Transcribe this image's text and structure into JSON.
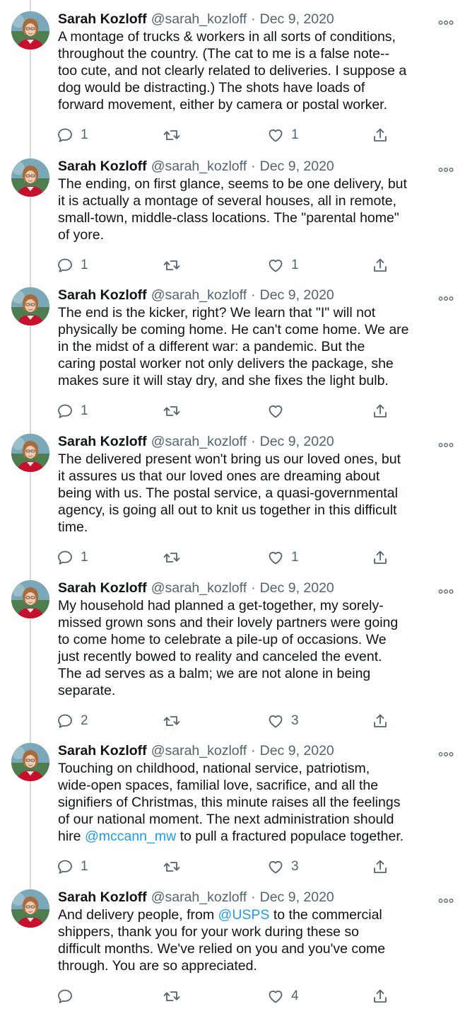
{
  "tweets": [
    {
      "name": "Sarah Kozloff",
      "handle": "@sarah_kozloff",
      "separator": "·",
      "date": "Dec 9, 2020",
      "lines": [
        [
          {
            "t": "A montage of trucks & workers in all sorts of conditions,"
          }
        ],
        [
          {
            "t": "throughout the country. (The cat to me is a false note--"
          }
        ],
        [
          {
            "t": "too cute, and not clearly related to deliveries. I suppose a"
          }
        ],
        [
          {
            "t": "dog would be distracting.) The shots have loads of"
          }
        ],
        [
          {
            "t": "forward movement, either by camera or postal worker."
          }
        ]
      ],
      "replies": "1",
      "retweets": "",
      "likes": "1"
    },
    {
      "name": "Sarah Kozloff",
      "handle": "@sarah_kozloff",
      "separator": "·",
      "date": "Dec 9, 2020",
      "lines": [
        [
          {
            "t": "The ending, on first glance, seems to be one delivery, but"
          }
        ],
        [
          {
            "t": "it is actually a montage of several houses, all in remote,"
          }
        ],
        [
          {
            "t": "small-town, middle-class locations. The \"parental home\""
          }
        ],
        [
          {
            "t": "of yore."
          }
        ]
      ],
      "replies": "1",
      "retweets": "",
      "likes": "1"
    },
    {
      "name": "Sarah Kozloff",
      "handle": "@sarah_kozloff",
      "separator": "·",
      "date": "Dec 9, 2020",
      "lines": [
        [
          {
            "t": "The end is the kicker, right? We learn that \"I\" will not"
          }
        ],
        [
          {
            "t": "physically be coming home. He can't come home. We are"
          }
        ],
        [
          {
            "t": "in the midst of a different war: a pandemic. But the"
          }
        ],
        [
          {
            "t": "caring postal worker not only delivers the package, she"
          }
        ],
        [
          {
            "t": "makes sure it will stay dry, and she fixes the light bulb."
          }
        ]
      ],
      "replies": "1",
      "retweets": "",
      "likes": ""
    },
    {
      "name": "Sarah Kozloff",
      "handle": "@sarah_kozloff",
      "separator": "·",
      "date": "Dec 9, 2020",
      "lines": [
        [
          {
            "t": "The delivered present won't bring us our loved ones, but"
          }
        ],
        [
          {
            "t": "it assures us that our loved ones are dreaming about"
          }
        ],
        [
          {
            "t": "being with us. The postal service, a quasi-governmental"
          }
        ],
        [
          {
            "t": "agency, is going all out to knit us together in this difficult"
          }
        ],
        [
          {
            "t": "time."
          }
        ]
      ],
      "replies": "1",
      "retweets": "",
      "likes": "1"
    },
    {
      "name": "Sarah Kozloff",
      "handle": "@sarah_kozloff",
      "separator": "·",
      "date": "Dec 9, 2020",
      "lines": [
        [
          {
            "t": "My household had planned a get-together, my sorely-"
          }
        ],
        [
          {
            "t": "missed grown sons and their lovely partners were going"
          }
        ],
        [
          {
            "t": "to come home to celebrate a pile-up of occasions. We"
          }
        ],
        [
          {
            "t": "just recently bowed to reality and canceled the event."
          }
        ],
        [
          {
            "t": "The ad serves as a balm; we are not alone in being"
          }
        ],
        [
          {
            "t": "separate."
          }
        ]
      ],
      "replies": "2",
      "retweets": "",
      "likes": "3"
    },
    {
      "name": "Sarah Kozloff",
      "handle": "@sarah_kozloff",
      "separator": "·",
      "date": "Dec 9, 2020",
      "lines": [
        [
          {
            "t": "Touching on childhood, national service, patriotism,"
          }
        ],
        [
          {
            "t": "wide-open spaces, familial love, sacrifice, and all the"
          }
        ],
        [
          {
            "t": "signifiers of Christmas, this minute raises all the feelings"
          }
        ],
        [
          {
            "t": "of our national moment. The next administration should"
          }
        ],
        [
          {
            "t": "hire "
          },
          {
            "t": "@mccann_mw",
            "mention": true
          },
          {
            "t": " to pull a fractured populace together."
          }
        ]
      ],
      "replies": "1",
      "retweets": "",
      "likes": "3"
    },
    {
      "name": "Sarah Kozloff",
      "handle": "@sarah_kozloff",
      "separator": "·",
      "date": "Dec 9, 2020",
      "lines": [
        [
          {
            "t": "And delivery people, from "
          },
          {
            "t": "@USPS",
            "mention": true
          },
          {
            "t": " to the commercial"
          }
        ],
        [
          {
            "t": "shippers, thank you for your work during these so"
          }
        ],
        [
          {
            "t": "difficult months. We've relied on you and you've come"
          }
        ],
        [
          {
            "t": "through. You are so appreciated."
          }
        ]
      ],
      "replies": "",
      "retweets": "",
      "likes": "4"
    }
  ],
  "icons": {
    "reply": "reply-icon",
    "retweet": "retweet-icon",
    "like": "heart-icon",
    "share": "share-icon",
    "more": "more-icon",
    "avatar": "profile-photo"
  },
  "colors": {
    "text": "#0f1419",
    "muted": "#536471",
    "mention": "#1d9bf0",
    "thread_line": "#cfd9de"
  }
}
